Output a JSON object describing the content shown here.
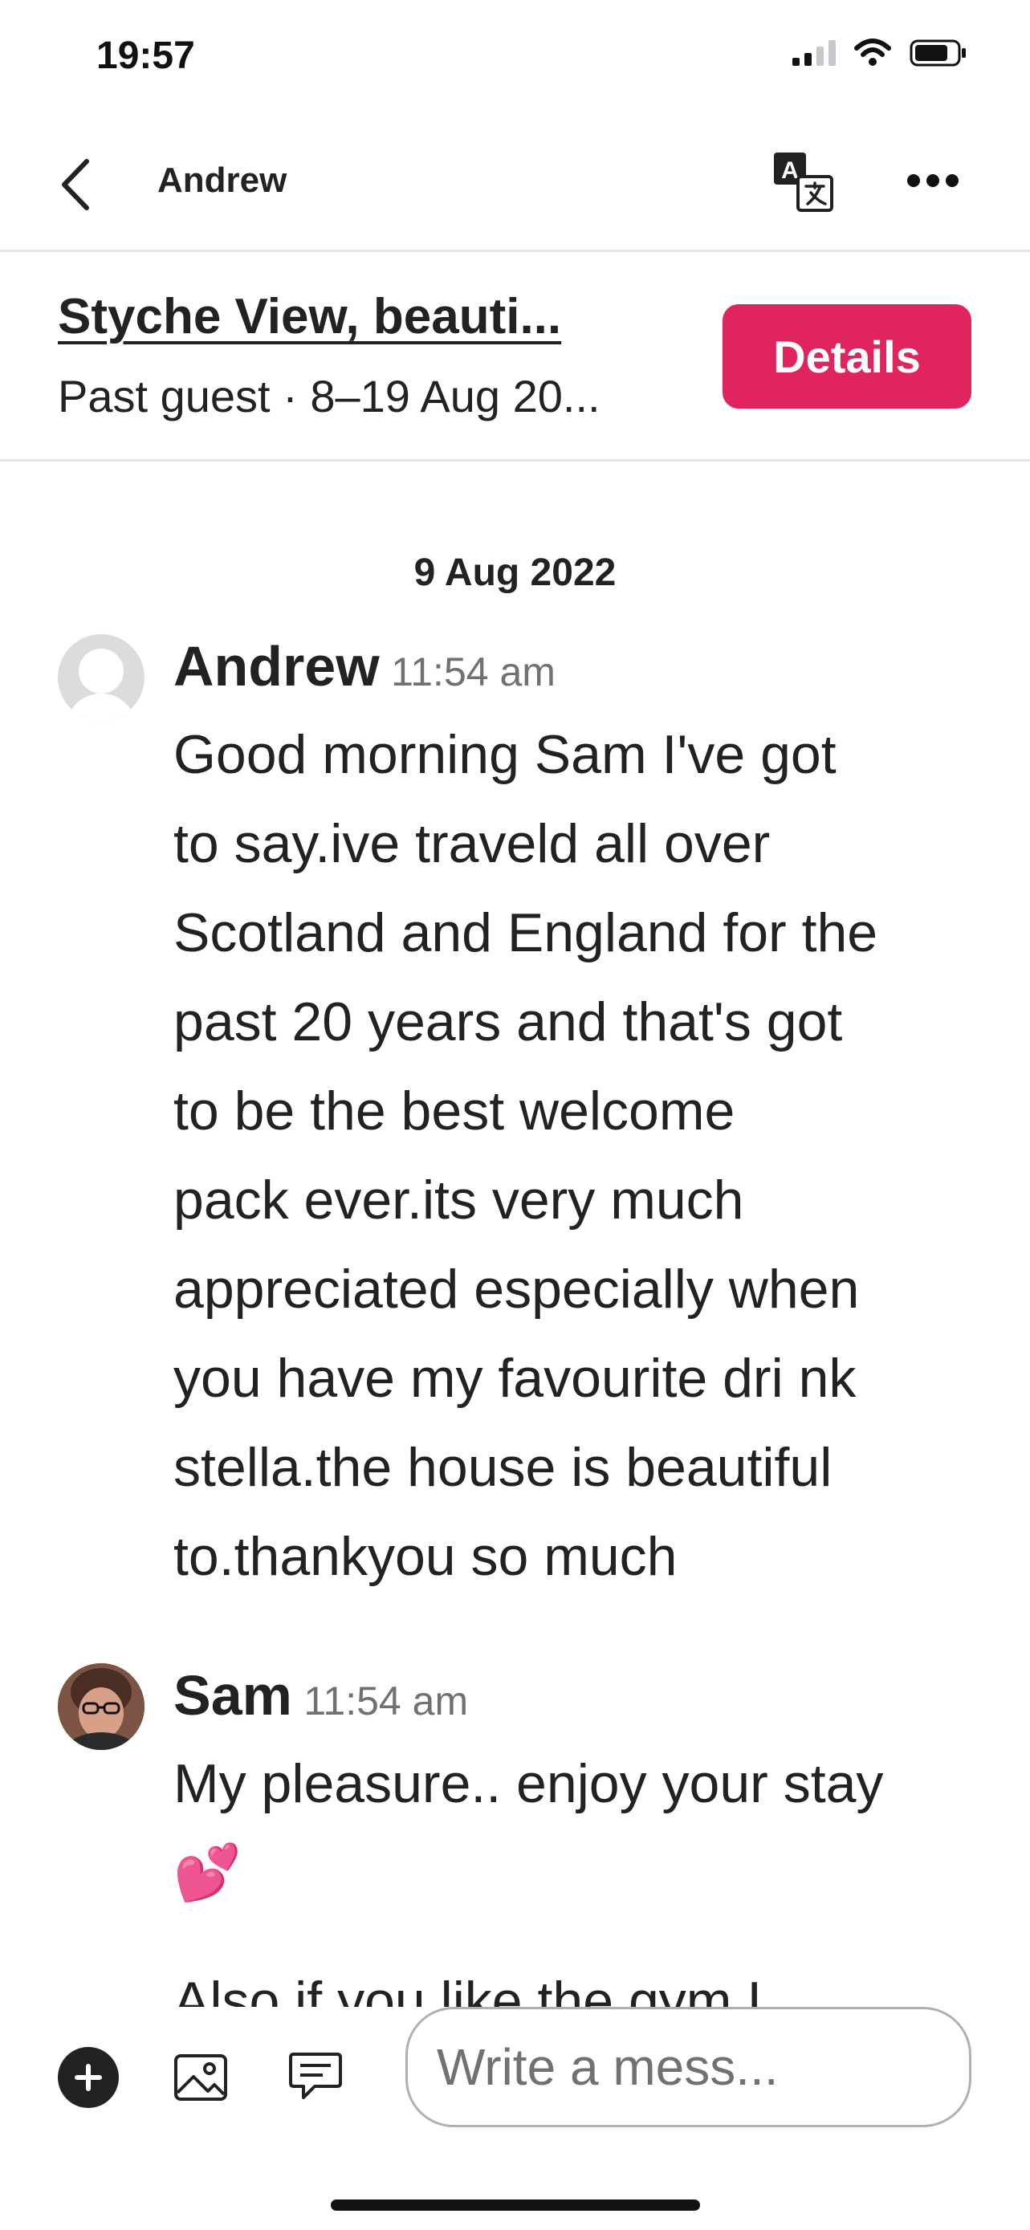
{
  "status_bar": {
    "time": "19:57"
  },
  "header": {
    "title": "Andrew"
  },
  "listing": {
    "title": "Styche View, beauti...",
    "subtitle": "Past guest · 8–19 Aug 20...",
    "details_label": "Details"
  },
  "chat": {
    "date": "9 Aug 2022",
    "messages": [
      {
        "sender": "Andrew",
        "time": "11:54 am",
        "text": "Good morning Sam I've got\nto say.ive traveld all over\nScotland and England for the\npast 20 years and that's got\nto be the best welcome\npack ever.its very much\nappreciated especially when\nyou have my favourite dri nk\nstella.the house is beautiful\nto.thankyou so much"
      },
      {
        "sender": "Sam",
        "time": "11:54 am",
        "text": "My pleasure.. enjoy your stay\n💕"
      }
    ],
    "partial_next": "Also if you like the gym I"
  },
  "composer": {
    "placeholder": "Write a mess..."
  },
  "colors": {
    "accent": "#e0245e",
    "text": "#222222",
    "muted": "#717171"
  },
  "icons": [
    "back-chevron-icon",
    "translate-icon",
    "more-icon",
    "add-icon",
    "image-icon",
    "quick-reply-icon"
  ]
}
